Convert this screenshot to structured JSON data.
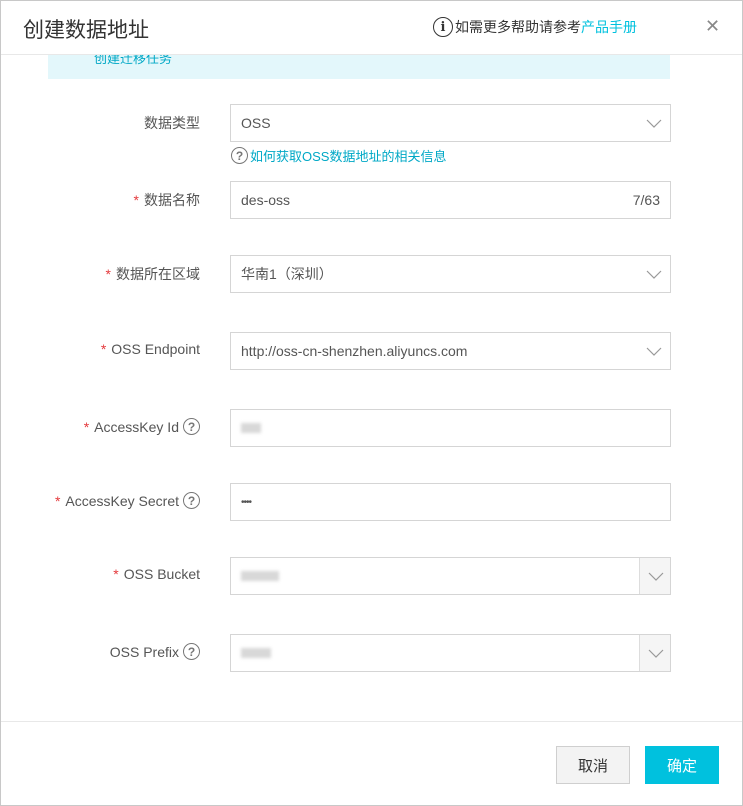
{
  "header": {
    "title": "创建数据地址",
    "help_text": "如需更多帮助请参考",
    "help_link": "产品手册"
  },
  "banner": {
    "text": "创建迁移任务"
  },
  "form": {
    "data_type": {
      "label": "数据类型",
      "value": "OSS"
    },
    "help_link": "如何获取OSS数据地址的相关信息",
    "data_name": {
      "label": "数据名称",
      "value": "des-oss",
      "count": "7/63"
    },
    "region": {
      "label": "数据所在区域",
      "value": "华南1（深圳）"
    },
    "endpoint": {
      "label": "OSS Endpoint",
      "value": "http://oss-cn-shenzhen.aliyuncs.com"
    },
    "access_key_id": {
      "label": "AccessKey Id"
    },
    "access_key_secret": {
      "label": "AccessKey Secret",
      "value": "••••"
    },
    "bucket": {
      "label": "OSS Bucket"
    },
    "prefix": {
      "label": "OSS Prefix"
    }
  },
  "footer": {
    "cancel": "取消",
    "ok": "确定"
  },
  "colors": {
    "accent": "#00c1de",
    "required": "#e4393c"
  }
}
